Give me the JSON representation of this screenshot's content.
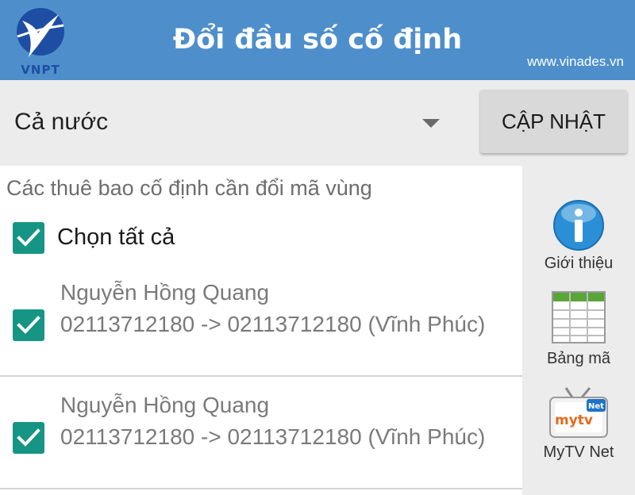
{
  "header": {
    "logo_text": "VNPT",
    "title": "Đổi đầu số cố định",
    "site": "www.vinades.vn"
  },
  "toolbar": {
    "region_value": "Cả nước",
    "update_label": "CẬP NHẬT"
  },
  "list": {
    "section_title": "Các thuê bao cố định cần đổi mã vùng",
    "select_all_label": "Chọn tất cả",
    "select_all_checked": true,
    "items": [
      {
        "name": "Nguyễn Hồng Quang",
        "detail": "02113712180 -> 02113712180 (Vĩnh Phúc)",
        "checked": true
      },
      {
        "name": "Nguyễn Hồng Quang",
        "detail": "02113712180 -> 02113712180 (Vĩnh Phúc)",
        "checked": true
      }
    ]
  },
  "side_menu": [
    {
      "label": "Giới thiệu",
      "icon": "info-icon"
    },
    {
      "label": "Bảng mã",
      "icon": "table-icon"
    },
    {
      "label": "MyTV Net",
      "icon": "mytv-tv-icon",
      "icon_text": "mytv",
      "badge_text": "Net"
    }
  ],
  "colors": {
    "header_bg": "#4e8fcb",
    "checkbox": "#169584",
    "page_bg": "#ececec"
  }
}
